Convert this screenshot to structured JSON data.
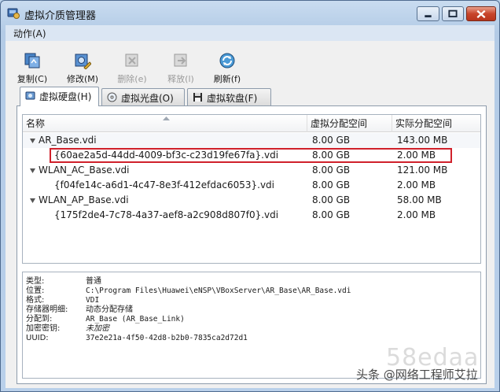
{
  "window": {
    "title": "虚拟介质管理器",
    "icons": {
      "app": "vbox-media-manager-icon",
      "minimize": "minimize-icon",
      "maximize": "maximize-icon",
      "close": "close-icon"
    }
  },
  "menu": {
    "items": [
      {
        "label": "动作(A)"
      }
    ]
  },
  "toolbar": {
    "buttons": [
      {
        "label": "复制(C)",
        "icon": "copy-disk-icon",
        "enabled": true
      },
      {
        "label": "修改(M)",
        "icon": "modify-disk-icon",
        "enabled": true
      },
      {
        "label": "删除(e)",
        "icon": "delete-disk-icon",
        "enabled": false
      },
      {
        "label": "释放(l)",
        "icon": "release-disk-icon",
        "enabled": false
      },
      {
        "label": "刷新(f)",
        "icon": "refresh-icon",
        "enabled": true
      }
    ]
  },
  "tabs": [
    {
      "label": "虚拟硬盘(H)",
      "icon": "hard-disk-icon",
      "active": true
    },
    {
      "label": "虚拟光盘(O)",
      "icon": "optical-disk-icon",
      "active": false
    },
    {
      "label": "虚拟软盘(F)",
      "icon": "floppy-disk-icon",
      "active": false
    }
  ],
  "list": {
    "columns": [
      "名称",
      "虚拟分配空间",
      "实际分配空间"
    ],
    "rows": [
      {
        "name": "AR_Base.vdi",
        "virtual": "8.00 GB",
        "actual": "143.00 MB",
        "level": 0
      },
      {
        "name": "{60ae2a5d-44dd-4009-bf3c-c23d19fe67fa}.vdi",
        "virtual": "8.00 GB",
        "actual": "2.00 MB",
        "level": 1
      },
      {
        "name": "WLAN_AC_Base.vdi",
        "virtual": "8.00 GB",
        "actual": "121.00 MB",
        "level": 0
      },
      {
        "name": "{f04fe14c-a6d1-4c47-8e3f-412efdac6053}.vdi",
        "virtual": "8.00 GB",
        "actual": "2.00 MB",
        "level": 1
      },
      {
        "name": "WLAN_AP_Base.vdi",
        "virtual": "8.00 GB",
        "actual": "58.00 MB",
        "level": 0
      },
      {
        "name": "{175f2de4-7c78-4a37-aef8-a2c908d807f0}.vdi",
        "virtual": "8.00 GB",
        "actual": "2.00 MB",
        "level": 1
      }
    ]
  },
  "details": [
    {
      "key": "类型:",
      "value": "普通"
    },
    {
      "key": "位置:",
      "value": "C:\\Program  Files\\Huawei\\eNSP\\VBoxServer\\AR_Base\\AR_Base.vdi"
    },
    {
      "key": "格式:",
      "value": "VDI"
    },
    {
      "key": "存储器明细:",
      "value": "动态分配存储"
    },
    {
      "key": "分配到:",
      "value": "AR_Base  (AR_Base_Link)"
    },
    {
      "key": "加密密钥:",
      "value": "未加密"
    },
    {
      "key": "UUID:",
      "value": "37e2e21a-4f50-42d8-b2b0-7835ca2d72d1"
    }
  ],
  "watermark": {
    "site": "58edaa",
    "caption": "头条 @网络工程师艾拉"
  },
  "colors": {
    "highlight_box": "#d0212b",
    "titlebar": "#c9dcf0"
  }
}
